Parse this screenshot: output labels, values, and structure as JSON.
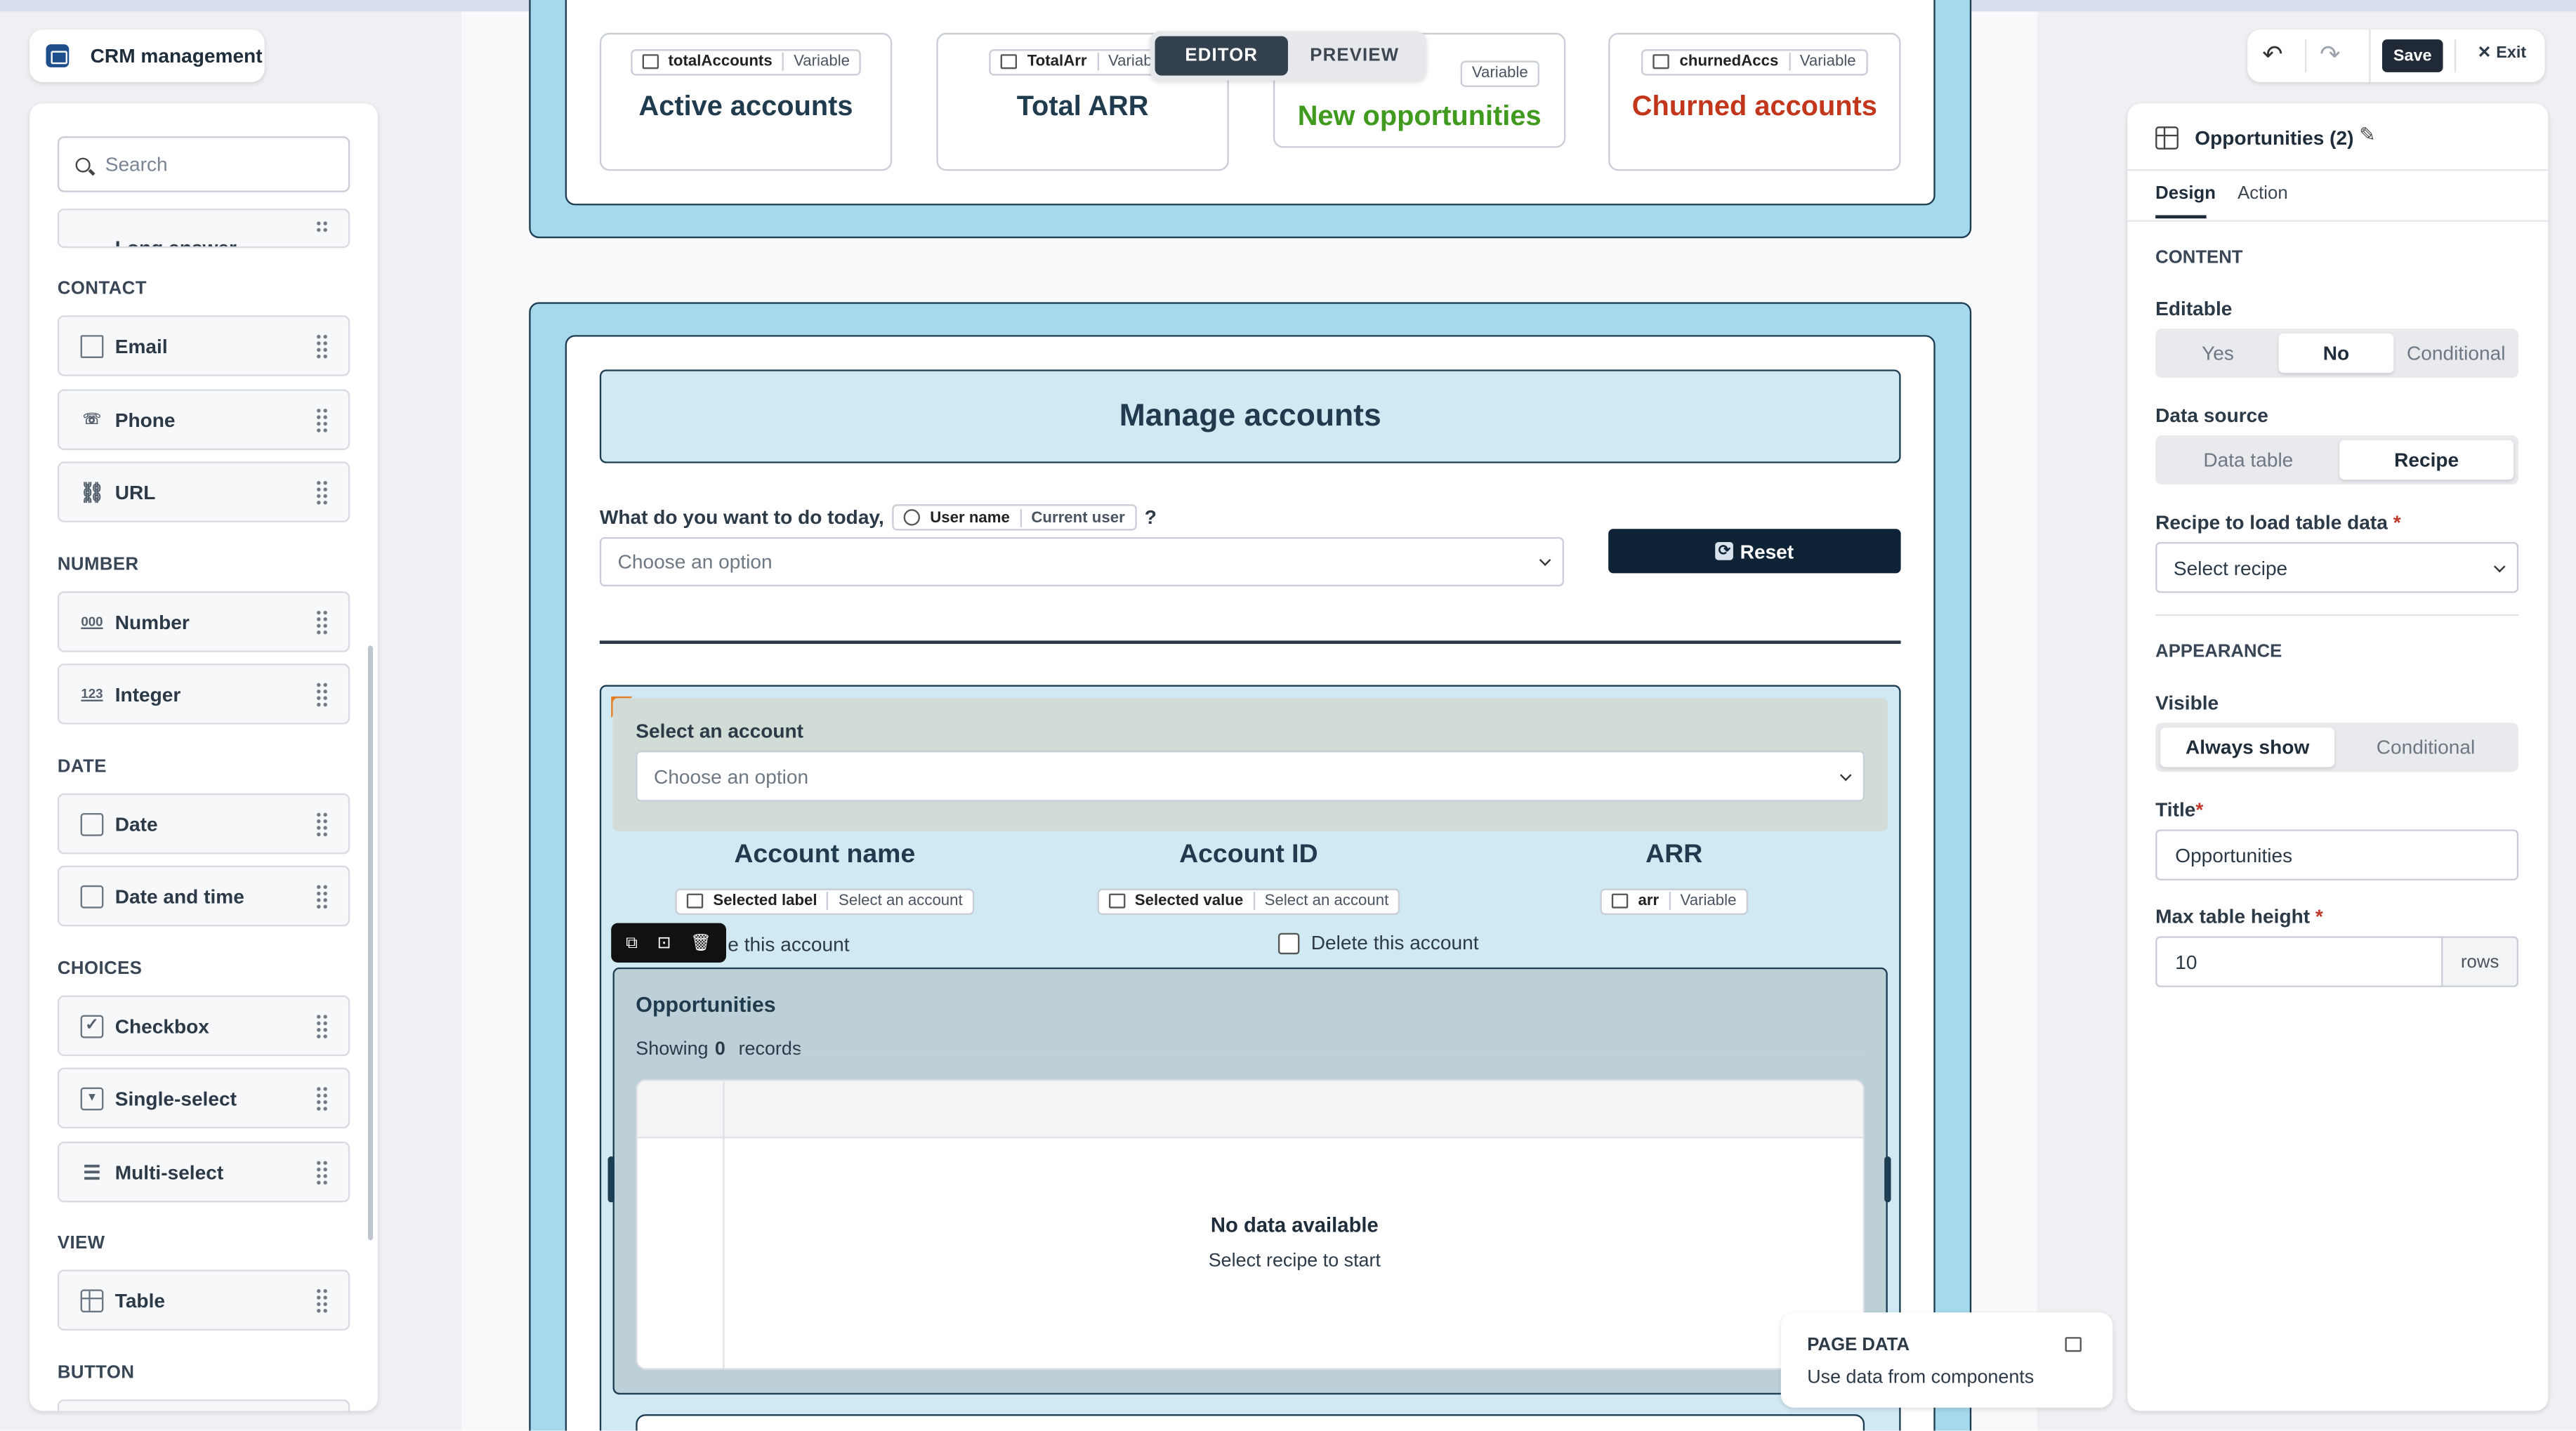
{
  "app": {
    "name": "CRM management"
  },
  "mode_toggle": {
    "editor": "EDITOR",
    "preview": "PREVIEW"
  },
  "toolbar": {
    "save": "Save",
    "exit": "Exit"
  },
  "palette": {
    "search_placeholder": "Search",
    "partial_item": "Long answer",
    "sections": {
      "contact": "CONTACT",
      "number": "NUMBER",
      "date": "DATE",
      "choices": "CHOICES",
      "view": "VIEW",
      "button": "BUTTON"
    },
    "items": {
      "email": "Email",
      "phone": "Phone",
      "url": "URL",
      "number": "Number",
      "integer": "Integer",
      "date": "Date",
      "datetime": "Date and time",
      "checkbox": "Checkbox",
      "single_select": "Single-select",
      "multi_select": "Multi-select",
      "table": "Table"
    }
  },
  "stats": [
    {
      "var": "totalAccounts",
      "tag": "Variable",
      "label": "Active accounts",
      "color": "#1f3b4d"
    },
    {
      "var": "TotalArr",
      "tag": "Variable",
      "label": "Total ARR",
      "color": "#1f3b4d"
    },
    {
      "var": "",
      "tag": "Variable",
      "label": "New opportunities",
      "color": "#3f9a1e"
    },
    {
      "var": "churnedAccs",
      "tag": "Variable",
      "label": "Churned accounts",
      "color": "#c2361b"
    }
  ],
  "manage": {
    "title": "Manage accounts",
    "question": "What do you want to do today,",
    "user_chip": {
      "a": "User name",
      "b": "Current user"
    },
    "question_end": "?",
    "placeholder": "Choose an option",
    "reset": "Reset",
    "select_account_label": "Select an account",
    "select_account_placeholder": "Choose an option",
    "columns": [
      {
        "title": "Account name",
        "chip_a": "Selected label",
        "chip_b": "Select an account"
      },
      {
        "title": "Account ID",
        "chip_a": "Selected value",
        "chip_b": "Select an account"
      },
      {
        "title": "ARR",
        "chip_a": "arr",
        "chip_b": "Variable"
      }
    ],
    "checkbox_left": "e this account",
    "checkbox_right": "Delete this account",
    "table": {
      "title": "Opportunities",
      "showing_prefix": "Showing",
      "showing_count": "0",
      "showing_suffix": "records",
      "empty_title": "No data available",
      "empty_sub": "Select recipe to start"
    }
  },
  "page_data_panel": {
    "title": "PAGE DATA",
    "sub": "Use data from components"
  },
  "props": {
    "title": "Opportunities (2)",
    "tabs": {
      "design": "Design",
      "action": "Action"
    },
    "content_header": "CONTENT",
    "editable_label": "Editable",
    "editable_options": [
      "Yes",
      "No",
      "Conditional"
    ],
    "editable_selected": "No",
    "datasource_label": "Data source",
    "datasource_options": [
      "Data table",
      "Recipe"
    ],
    "datasource_selected": "Recipe",
    "recipe_label": "Recipe to load table data",
    "recipe_placeholder": "Select recipe",
    "appearance_header": "APPEARANCE",
    "visible_label": "Visible",
    "visible_options": [
      "Always show",
      "Conditional"
    ],
    "visible_selected": "Always show",
    "title_label": "Title",
    "title_value": "Opportunities",
    "maxh_label": "Max table height",
    "maxh_value": "10",
    "maxh_unit": "rows"
  }
}
